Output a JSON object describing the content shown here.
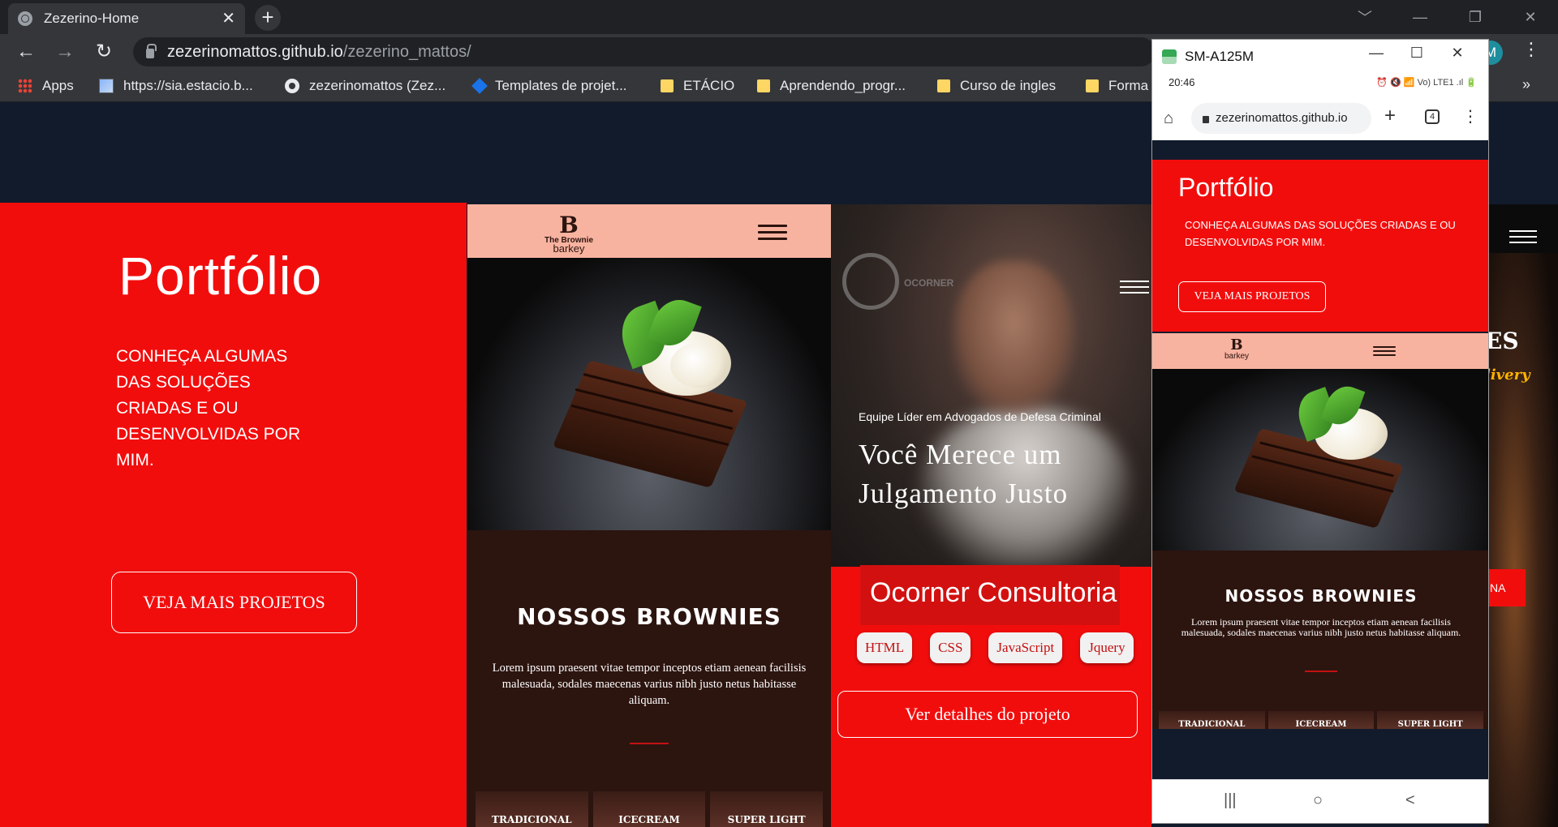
{
  "browser": {
    "tab_title": "Zezerino-Home",
    "tab_close": "✕",
    "new_tab": "+",
    "url_host": "zezerinomattos.github.io",
    "url_path": "/zezerino_mattos/",
    "profile_initial": "M",
    "window_controls": [
      "﹀",
      "—",
      "❐",
      "✕"
    ],
    "nav": {
      "back": "←",
      "forward": "→",
      "reload": "↻",
      "menu": "⋮"
    },
    "bookmarks": [
      {
        "label": "Apps",
        "icon": "apps-grid-icon"
      },
      {
        "label": "https://sia.estacio.b...",
        "icon": "site-icon"
      },
      {
        "label": "zezerinomattos (Zez...",
        "icon": "github-icon"
      },
      {
        "label": "Templates de projet...",
        "icon": "jira-icon"
      },
      {
        "label": "ETÁCIO",
        "icon": "folder-icon"
      },
      {
        "label": "Aprendendo_progr...",
        "icon": "folder-icon"
      },
      {
        "label": "Curso de ingles",
        "icon": "folder-icon"
      },
      {
        "label": "Forma",
        "icon": "folder-icon"
      }
    ],
    "bookmarks_more": "»"
  },
  "hero": {
    "title": "Portfólio",
    "text": "CONHEÇA ALGUMAS DAS SOLUÇÕES CRIADAS E OU DESENVOLVIDAS POR MIM.",
    "button": "VEJA MAIS PROJETOS"
  },
  "brownie_card": {
    "logo_letter": "B",
    "logo_line1": "The Brownie",
    "logo_line2": "barkey",
    "heading": "NOSSOS BROWNIES",
    "text": "Lorem ipsum praesent vitae tempor inceptos etiam aenean facilisis malesuada, sodales maecenas varius nibh justo netus habitasse aliquam.",
    "thumbs": [
      "TRADICIONAL",
      "ICECREAM",
      "SUPER LIGHT"
    ]
  },
  "ocorner_card": {
    "logo_text": "OCORNER",
    "subtitle": "Equipe Líder em Advogados de Defesa Criminal",
    "headline_line1": "Você Merece um",
    "headline_line2": "Julgamento Justo",
    "title": "Ocorner Consultoria",
    "chips": [
      "HTML",
      "CSS",
      "JavaScript",
      "Jquery"
    ],
    "button": "Ver detalhes do projeto"
  },
  "burger_card": {
    "heading_fragment": "ES",
    "tagline_fragment": "livery",
    "button_fragment": "NA"
  },
  "phone": {
    "window_title": "SM-A125M",
    "controls": [
      "—",
      "☐",
      "✕"
    ],
    "time": "20:46",
    "status_icons": "⏰ 🔇 📶 Vo) LTE1 .ıl 🔋",
    "url": "zezerinomattos.github.io",
    "tab_count": "4",
    "nav_buttons": [
      "|||",
      "○",
      "<"
    ],
    "home_icon": "⌂",
    "plus": "+",
    "kebab": "⋮"
  }
}
